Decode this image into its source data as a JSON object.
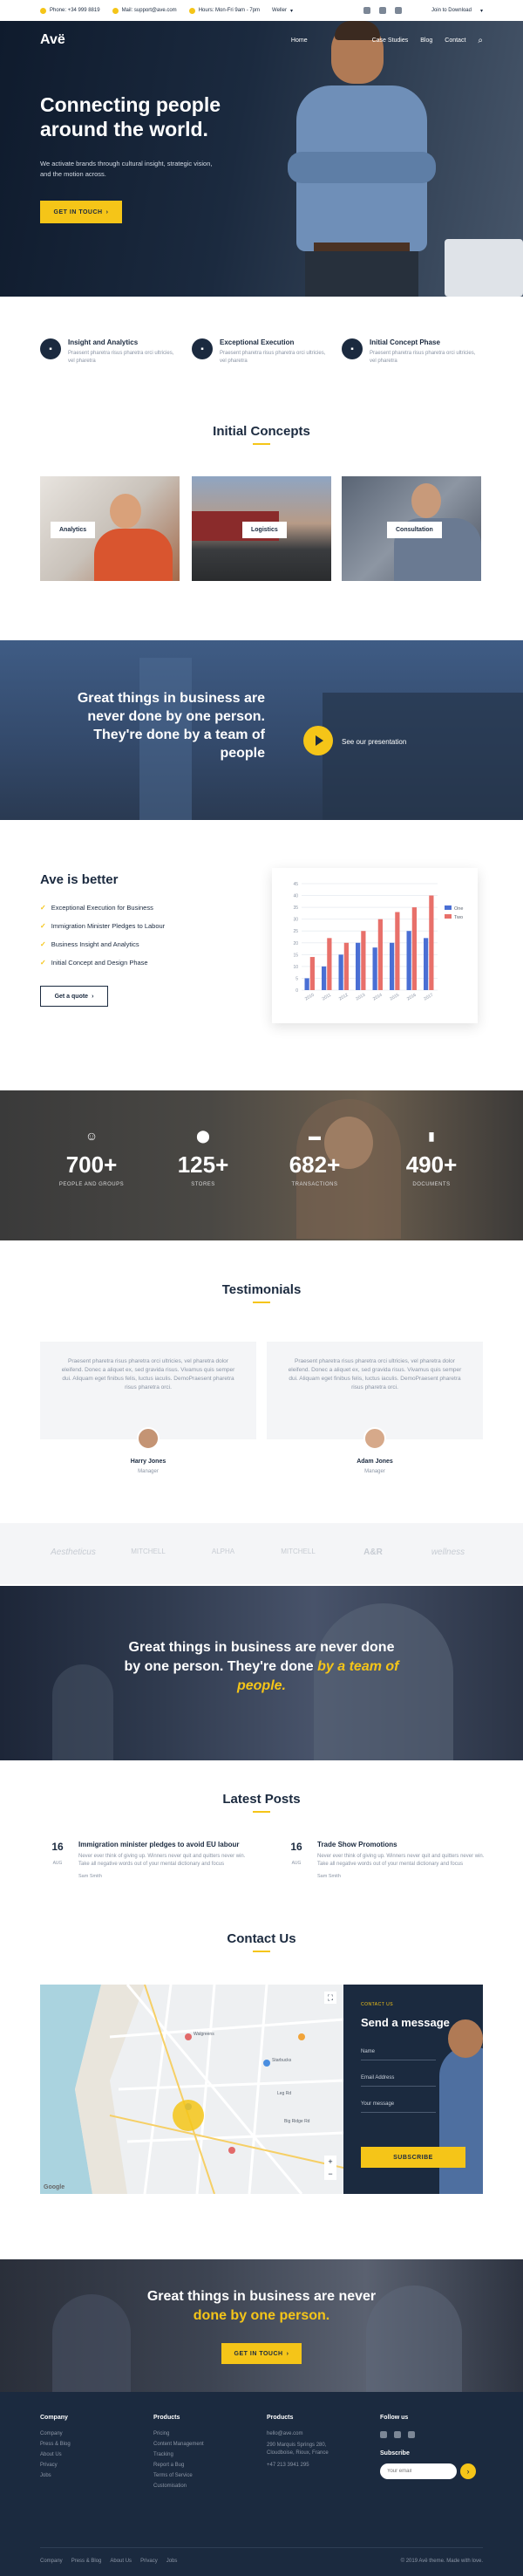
{
  "topbar": {
    "phone": "Phone: +34 999 8819",
    "mail": "Mail: support@ave.com",
    "hours": "Hours: Mon-Fri 9am - 7pm",
    "lang": "Weller",
    "download": "Join to Download"
  },
  "nav": {
    "logo": "Avë",
    "links": [
      "Home",
      "Case Studies",
      "Blog",
      "Contact"
    ]
  },
  "hero": {
    "title": "Connecting people around the world.",
    "subtitle": "We activate brands through cultural insight, strategic vision, and the motion across.",
    "cta": "GET IN TOUCH"
  },
  "features": [
    {
      "title": "Insight and Analytics",
      "text": "Praesent pharetra risus pharetra orci ultricies, vel pharetra"
    },
    {
      "title": "Exceptional Execution",
      "text": "Praesent pharetra risus pharetra orci ultricies, vel pharetra"
    },
    {
      "title": "Initial Concept Phase",
      "text": "Praesent pharetra risus pharetra orci ultricies, vel pharetra"
    }
  ],
  "concepts": {
    "title": "Initial Concepts",
    "items": [
      "Analytics",
      "Logistics",
      "Consultation"
    ]
  },
  "banner1": {
    "text": "Great things in business are never done by one person. They're done by a team of people",
    "cta": "See our presentation"
  },
  "better": {
    "title": "Ave is better",
    "items": [
      "Exceptional Execution for Business",
      "Immigration Minister Pledges to Labour",
      "Business Insight and Analytics",
      "Initial Concept and Design Phase"
    ],
    "cta": "Get a quote"
  },
  "chart_data": {
    "type": "bar",
    "categories": [
      "2010",
      "2011",
      "2012",
      "2013",
      "2014",
      "2015",
      "2016",
      "2017"
    ],
    "series": [
      {
        "name": "One",
        "color": "#4a6fd4",
        "values": [
          5,
          10,
          15,
          20,
          18,
          20,
          25,
          22
        ]
      },
      {
        "name": "Two",
        "color": "#e8706a",
        "values": [
          14,
          22,
          20,
          25,
          30,
          33,
          35,
          40
        ]
      }
    ],
    "ylim": [
      0,
      45
    ],
    "yticks": [
      0,
      5,
      10,
      15,
      20,
      25,
      30,
      35,
      40,
      45
    ],
    "legend": "right",
    "grid": true
  },
  "stats": [
    {
      "icon": "smile-icon",
      "value": "700+",
      "label": "PEOPLE AND GROUPS"
    },
    {
      "icon": "map-pin-icon",
      "value": "125+",
      "label": "STORES"
    },
    {
      "icon": "card-icon",
      "value": "682+",
      "label": "TRANSACTIONS"
    },
    {
      "icon": "folder-icon",
      "value": "490+",
      "label": "DOCUMENTS"
    }
  ],
  "testimonials": {
    "title": "Testimonials",
    "items": [
      {
        "quote": "Praesent pharetra risus pharetra orci ultricies, vel pharetra dolor eleifend. Donec a aliquet ex, sed gravida risus. Vivamus quis semper dui. Aliquam eget finibus felis, luctus iaculis. DemoPraesent pharetra risus pharetra orci.",
        "name": "Harry Jones",
        "role": "Manager"
      },
      {
        "quote": "Praesent pharetra risus pharetra orci ultricies, vel pharetra dolor eleifend. Donec a aliquet ex, sed gravida risus. Vivamus quis semper dui. Aliquam eget finibus felis, luctus iaculis. DemoPraesent pharetra risus pharetra orci.",
        "name": "Adam Jones",
        "role": "Manager"
      }
    ]
  },
  "brands": [
    "Aestheticus",
    "MITCHELL",
    "ALPHA",
    "MITCHELL",
    "A&R",
    "wellness"
  ],
  "banner2": {
    "lead": "Great things in business are never done by one person. They're done",
    "accent": "by a team of people."
  },
  "posts": {
    "title": "Latest Posts",
    "items": [
      {
        "day": "16",
        "month": "AUG",
        "title": "Immigration minister pledges to avoid EU labour",
        "text": "Never ever think of giving up. Winners never quit and quitters never win. Take all negative words out of your mental dictionary and focus",
        "by": "Sam Smith"
      },
      {
        "day": "16",
        "month": "AUG",
        "title": "Trade Show Promotions",
        "text": "Never ever think of giving up. Winners never quit and quitters never win. Take all negative words out of your mental dictionary and focus",
        "by": "Sam Smith"
      }
    ]
  },
  "contact": {
    "title": "Contact Us",
    "kicker": "CONTACT US",
    "form_title": "Send a message",
    "fields": [
      "Name",
      "Email Address",
      "Your message"
    ],
    "submit": "SUBSCRIBE",
    "map_labels": [
      "Walgreens",
      "Starbucks",
      "Leg Rd",
      "Big Ridge Rd"
    ]
  },
  "banner3": {
    "lead": "Great things in business are never",
    "accent": "done by one person.",
    "cta": "GET IN TOUCH"
  },
  "footer": {
    "cols": [
      {
        "title": "Company",
        "items": [
          "Company",
          "Press & Blog",
          "About Us",
          "Privacy",
          "Jobs"
        ]
      },
      {
        "title": "Products",
        "items": [
          "Pricing",
          "Content Management",
          "Tracking",
          "Report a Bug",
          "Terms of Service",
          "Customisation"
        ]
      },
      {
        "title": "Products",
        "items": [
          "hello@ave.com",
          "290 Marquis Springs 280, Cloudboise, Rioux, France",
          "+47 213 3941 295"
        ]
      }
    ],
    "follow": "Follow us",
    "subscribe": "Subscribe",
    "email_placeholder": "Your email",
    "bottom_links": [
      "Company",
      "Press & Blog",
      "About Us",
      "Privacy",
      "Jobs"
    ],
    "copyright": "© 2019 Avë theme. Made with love."
  }
}
